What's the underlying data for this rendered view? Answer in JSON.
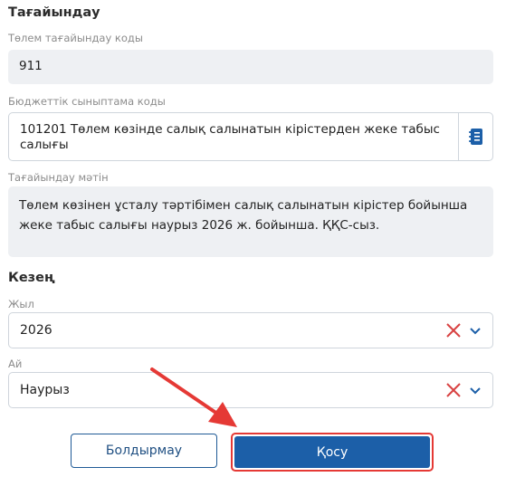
{
  "purpose": {
    "title": "Тағайындау",
    "code_label": "Төлем тағайындау коды",
    "code_value": "911",
    "classification_label": "Бюджеттік сыныптама коды",
    "classification_value": "101201 Төлем көзінде салық салынатын кірістерден жеке табыс салығы",
    "text_label": "Тағайындау мәтін",
    "text_value": "Төлем көзінен ұсталу тәртібімен салық салынатын кірістер бойынша жеке табыс салығы наурыз 2026 ж. бойынша. ҚҚС-сыз."
  },
  "period": {
    "title": "Кезең",
    "year_label": "Жыл",
    "year_value": "2026",
    "month_label": "Ай",
    "month_value": "Наурыз"
  },
  "actions": {
    "cancel_label": "Болдырмау",
    "add_label": "Қосу"
  },
  "colors": {
    "primary": "#1c5fa8",
    "highlight": "#e53935",
    "clear_icon": "#d84343"
  },
  "icons": [
    "directory-book-icon",
    "clear-x-icon",
    "chevron-down-icon",
    "red-arrow-annotation"
  ]
}
